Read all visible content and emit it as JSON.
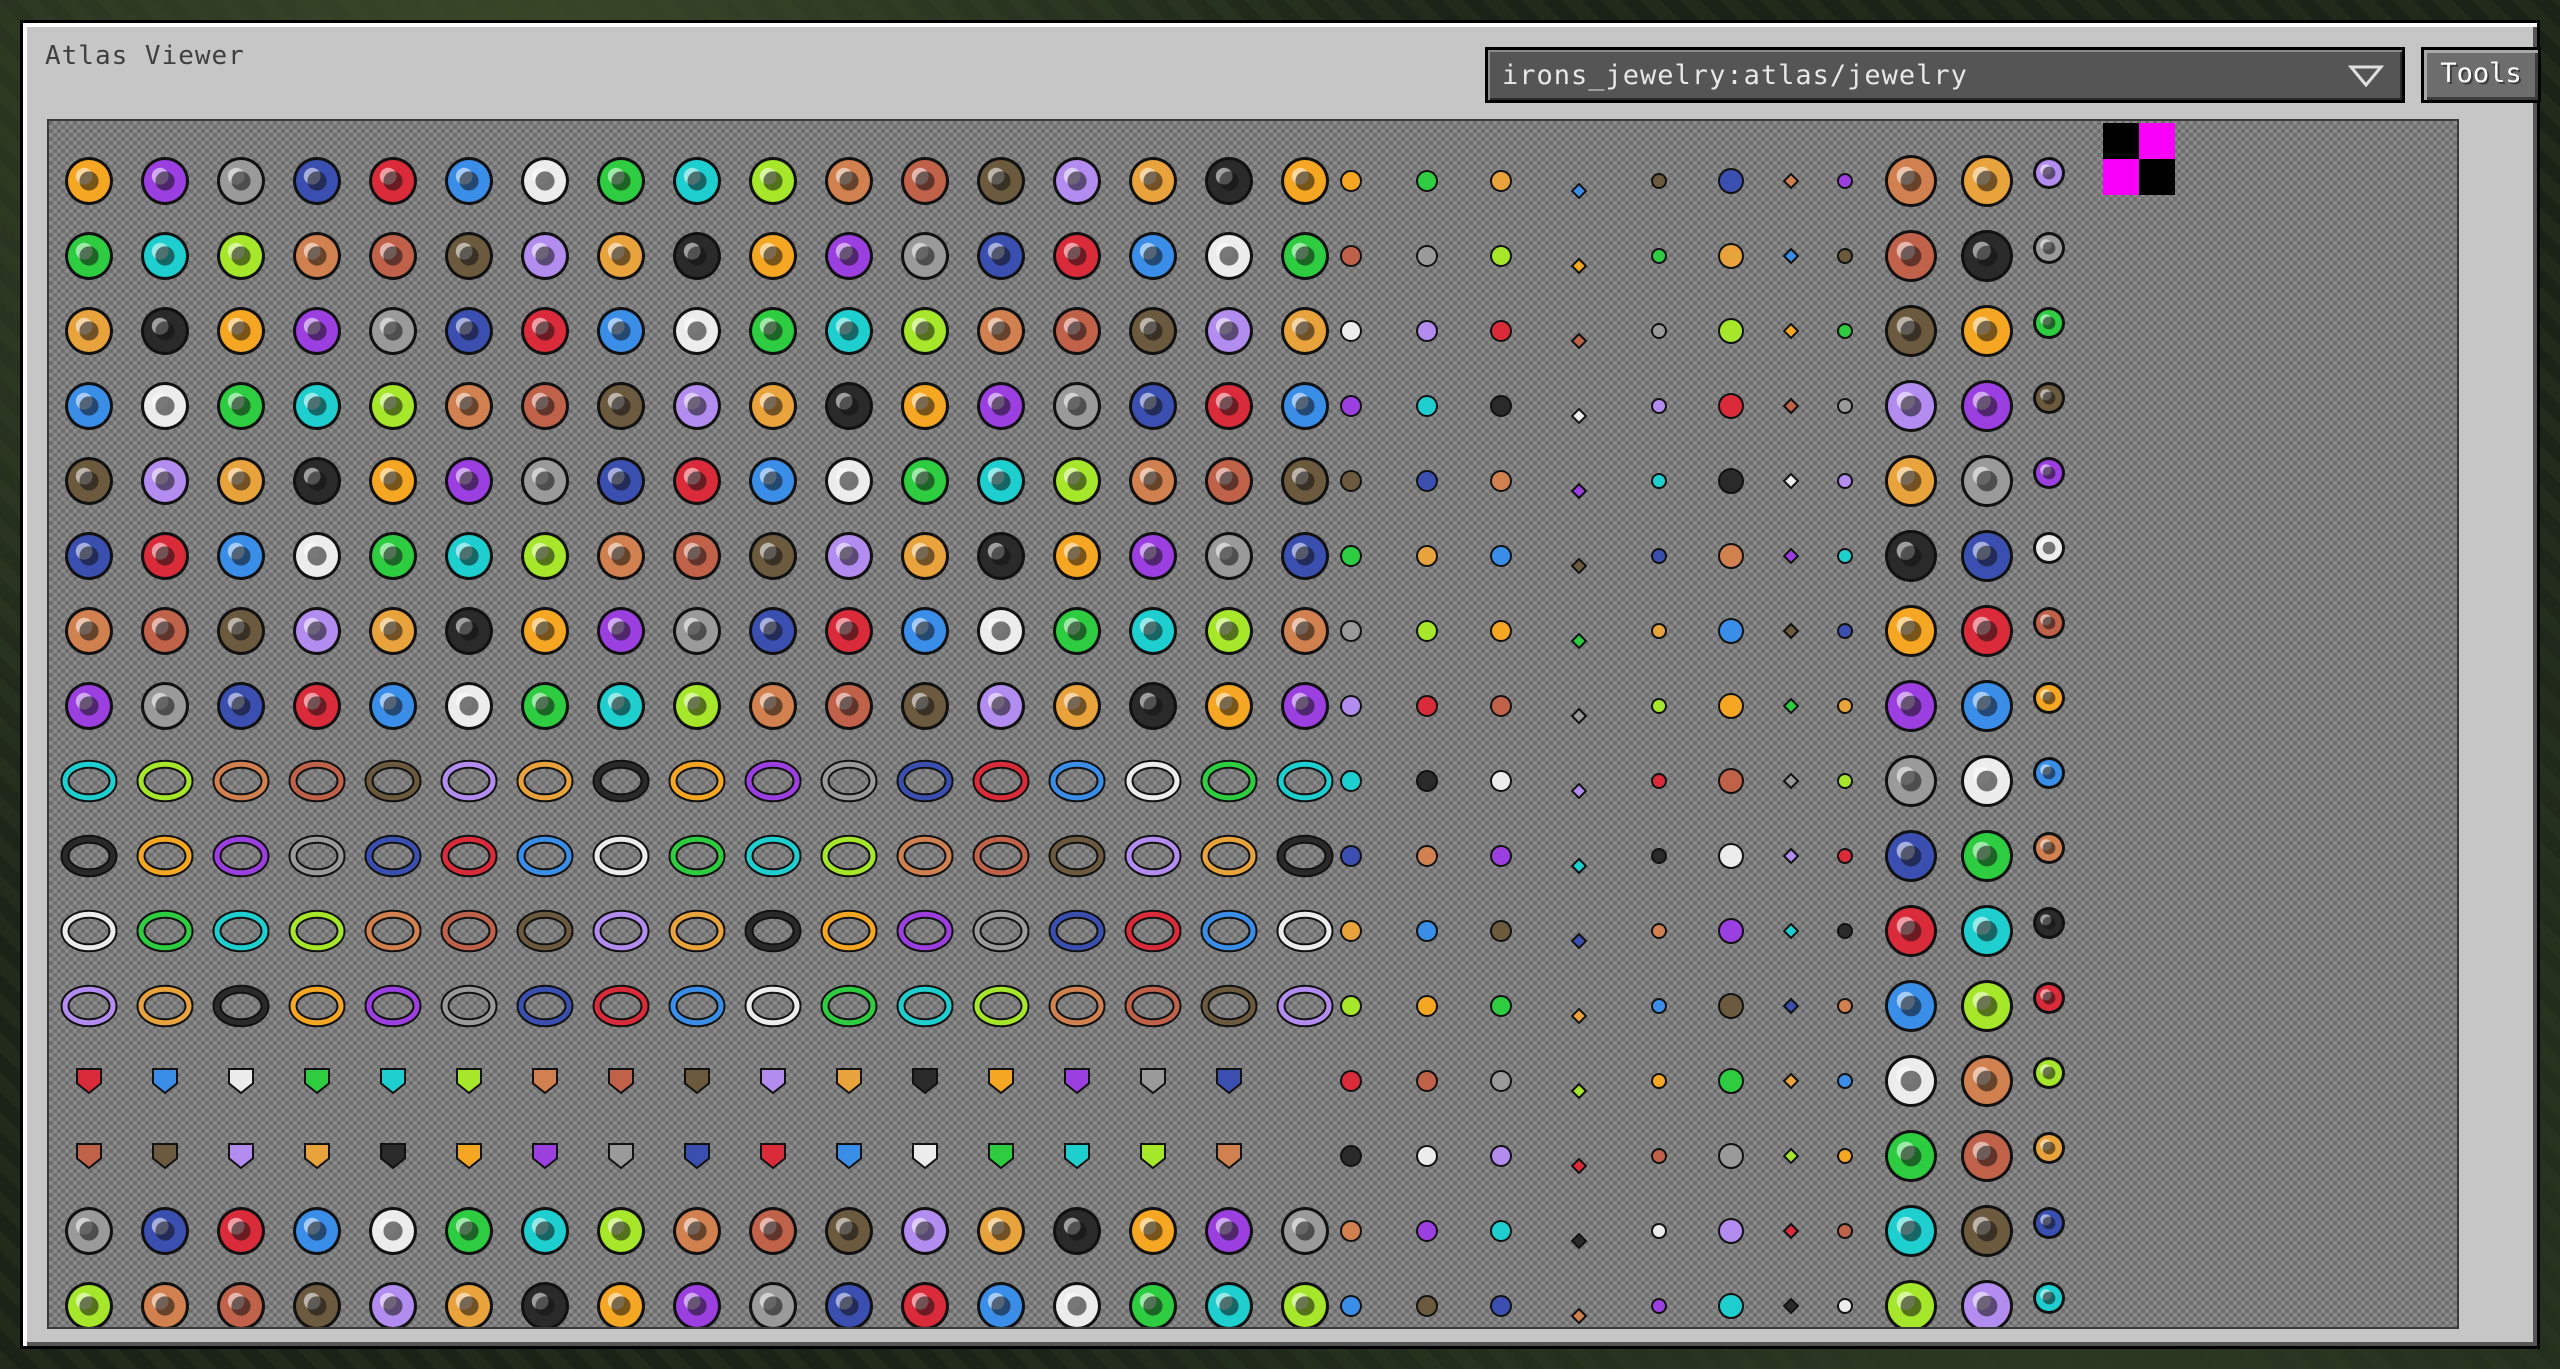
{
  "window": {
    "title": "Atlas Viewer"
  },
  "atlas_selector": {
    "value": "irons_jewelry:atlas/jewelry",
    "icon": "chevron-down-icon"
  },
  "toolbar": {
    "tools_label": "Tools"
  },
  "atlas": {
    "background": "checkerboard transparency",
    "missing_texture_colors": [
      "#000000",
      "#f800f8"
    ],
    "palette": [
      "#f5a623",
      "#b38cf0",
      "#d1804f",
      "#2ecc40",
      "#d92b3a",
      "#9b3fe0",
      "#e8a33d",
      "#c0614a",
      "#1fcfcf",
      "#3a8ee8",
      "#9a9a9a",
      "#2a2a2a",
      "#6b5a3e",
      "#a6e62b",
      "#ececec",
      "#3a4fb0"
    ]
  }
}
